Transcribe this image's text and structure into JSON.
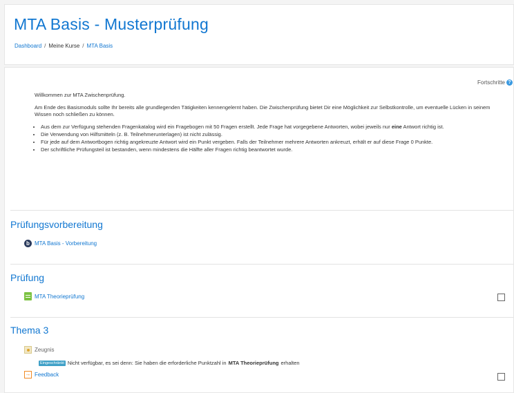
{
  "header": {
    "title": "MTA Basis - Musterprüfung",
    "breadcrumb": [
      {
        "label": "Dashboard",
        "link": true
      },
      {
        "label": "Meine Kurse",
        "link": false
      },
      {
        "label": "MTA Basis",
        "link": true
      }
    ],
    "separator": "/"
  },
  "main": {
    "progress_label": "Fortschritte",
    "intro": {
      "welcome": "Willkommen zur MTA Zwischenprüfung.",
      "paragraph": "Am Ende des Basismoduls sollte Ihr bereits alle grundlegenden Tätigkeiten kennengelernt haben. Die Zwischenprüfung bietet Dir eine Möglichkeit zur Selbstkontrolle, um eventuelle Lücken in seinem Wissen noch schließen zu können.",
      "bullet1_pre": "Aus dem zur Verfügung stehenden Fragenkatalog wird ein Fragebogen mit 50 Fragen erstellt. Jede Frage hat vorgegebene Antworten, wobei jeweils nur ",
      "bullet1_bold": "eine",
      "bullet1_post": " Antwort richtig ist.",
      "bullet2": "Die Verwendung von Hilfsmitteln (z. B. Teilnehmerunterlagen) ist nicht zulässig.",
      "bullet3": "Für jede auf dem Antwortbogen richtig angekreuzte Antwort wird ein Punkt vergeben. Falls der Teilnehmer mehrere Antworten ankreuzt, erhält er auf diese Frage 0 Punkte.",
      "bullet4": "Der schriftliche Prüfungsteil ist bestanden, wenn mindestens die Hälfte aller Fragen richtig beantwortet wurde."
    },
    "sections": {
      "prep": {
        "title": "Prüfungsvorbereitung",
        "activity": "MTA Basis - Vorbereitung"
      },
      "exam": {
        "title": "Prüfung",
        "activity": "MTA Theorieprüfung"
      },
      "topic3": {
        "title": "Thema 3",
        "certificate": "Zeugnis",
        "restriction_badge": "Eingeschränkt",
        "restriction_pre": "Nicht verfügbar, es sei denn: Sie haben die erforderliche Punktzahl in",
        "restriction_bold": "MTA Theorieprüfung",
        "restriction_post": "erhalten",
        "feedback": "Feedback"
      }
    }
  },
  "icons": {
    "help": "question-circle-icon",
    "prep": "bigbluebutton-icon",
    "quiz": "quiz-icon",
    "certificate": "certificate-icon",
    "feedback": "feedback-icon"
  }
}
